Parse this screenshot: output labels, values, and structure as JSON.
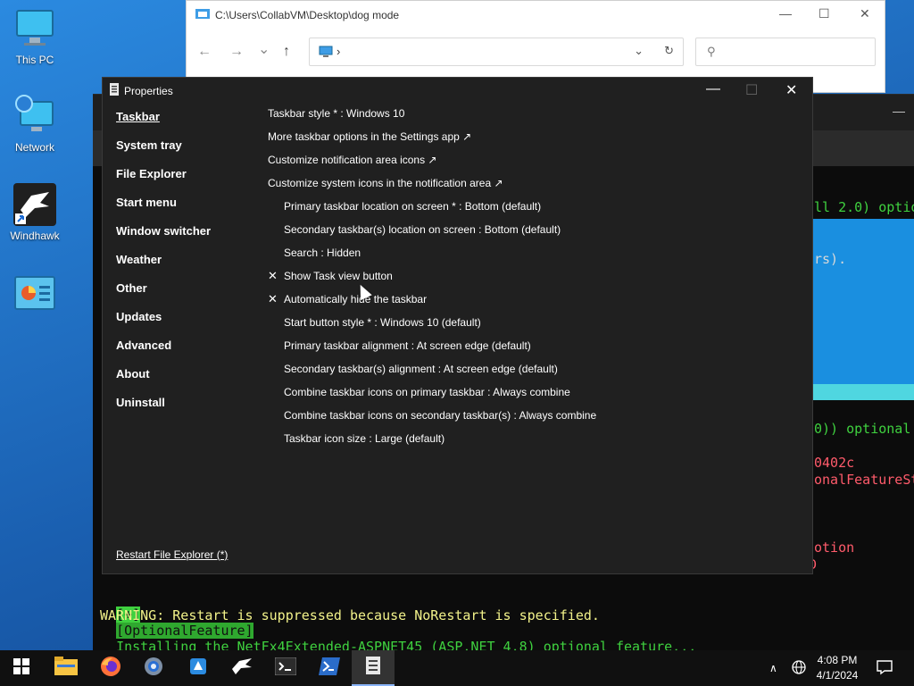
{
  "desktop": {
    "icons": [
      {
        "label": "This PC"
      },
      {
        "label": "Network"
      },
      {
        "label": "Windhawk"
      },
      {
        "label": ""
      }
    ]
  },
  "explorer": {
    "title": "C:\\Users\\CollabVM\\Desktop\\dog mode",
    "address_sep": "›",
    "controls": {
      "minimize": "—",
      "maximize": "☐",
      "close": "✕"
    },
    "nav": {
      "back": "←",
      "forward": "→",
      "recent": "⌄",
      "up": "↑",
      "refresh": "↻"
    },
    "search_icon": "⚲"
  },
  "terminal": {
    "lines": [
      {
        "text": "ll 2.0) optio",
        "color": "#3fd13f"
      },
      {
        "text": "rs).",
        "color": "#d8d8d8"
      },
      {
        "text": "0)) optional",
        "color": "#3fd13f"
      },
      {
        "text": "0402c",
        "color": "#ff5b6b"
      },
      {
        "text": "onalFeatureSta",
        "color": "#ff5b6b"
      },
      {
        "text": "otion",
        "color": "#ff5b6b"
      },
      {
        "text": "D",
        "color": "#ff5b6b"
      }
    ],
    "install_prefix": "[+]",
    "install_tag": "[OptionalFeature]",
    "install_text": "Installing the NetFx4Extended-ASPNET45 (ASP.NET 4.8) optional feature...",
    "warning": "WARNING: Restart is suppressed because NoRestart is specified."
  },
  "dialog": {
    "title": "Properties",
    "controls": {
      "minimize": "—",
      "maximize": "☐",
      "close": "✕"
    },
    "nav": [
      {
        "label": "Taskbar",
        "active": true
      },
      {
        "label": "System tray"
      },
      {
        "label": "File Explorer"
      },
      {
        "label": "Start menu"
      },
      {
        "label": "Window switcher"
      },
      {
        "label": "Weather"
      },
      {
        "label": "Other"
      },
      {
        "label": "Updates"
      },
      {
        "label": "Advanced"
      },
      {
        "label": "About"
      },
      {
        "label": "Uninstall"
      }
    ],
    "restart_link": "Restart File Explorer (*)",
    "options": [
      {
        "label": "Taskbar style * : Windows 10",
        "indent": false,
        "checked": false
      },
      {
        "label": "More taskbar options in the Settings app ↗",
        "indent": false,
        "checked": false
      },
      {
        "label": "Customize notification area icons ↗",
        "indent": false,
        "checked": false
      },
      {
        "label": "Customize system icons in the notification area ↗",
        "indent": false,
        "checked": false
      },
      {
        "label": "Primary taskbar location on screen * : Bottom (default)",
        "indent": true,
        "checked": false
      },
      {
        "label": "Secondary taskbar(s) location on screen : Bottom (default)",
        "indent": true,
        "checked": false
      },
      {
        "label": "Search : Hidden",
        "indent": true,
        "checked": false
      },
      {
        "label": "Show Task view button",
        "indent": true,
        "checked": true
      },
      {
        "label": "Automatically hide the taskbar",
        "indent": true,
        "checked": true
      },
      {
        "label": "Start button style * : Windows 10 (default)",
        "indent": true,
        "checked": false
      },
      {
        "label": "Primary taskbar alignment : At screen edge (default)",
        "indent": true,
        "checked": false
      },
      {
        "label": "Secondary taskbar(s) alignment : At screen edge (default)",
        "indent": true,
        "checked": false
      },
      {
        "label": "Combine taskbar icons on primary taskbar : Always combine",
        "indent": true,
        "checked": false
      },
      {
        "label": "Combine taskbar icons on secondary taskbar(s) : Always combine",
        "indent": true,
        "checked": false
      },
      {
        "label": "Taskbar icon size : Large (default)",
        "indent": true,
        "checked": false
      }
    ],
    "check_glyph": "✕"
  },
  "taskbar": {
    "time": "4:08 PM",
    "date": "4/1/2024",
    "apps": [
      "start",
      "file-explorer",
      "firefox",
      "settings",
      "snipping",
      "windhawk",
      "terminal",
      "powershell",
      "properties"
    ],
    "tray_chevron": "∧",
    "colors": {
      "bg": "#101010",
      "active": "#333333"
    }
  }
}
